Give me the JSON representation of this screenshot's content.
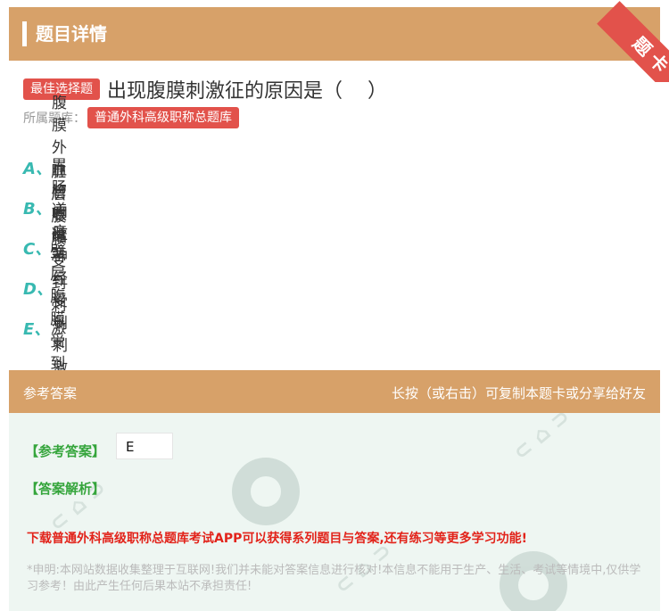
{
  "header": {
    "title": "题目详情",
    "ribbon": "题卡"
  },
  "question": {
    "type_tag": "最佳选择题",
    "text": "出现腹膜刺激征的原因是（    ）",
    "bank_label": "所属题库：",
    "bank_name": "普通外科高级职称总题库"
  },
  "options": [
    {
      "letter": "A、",
      "text": "腹膜外血管收缩"
    },
    {
      "letter": "B、",
      "text": "胃肠道痉挛"
    },
    {
      "letter": "C、",
      "text": "脏层腹膜受到刺激"
    },
    {
      "letter": "D、",
      "text": "内脏神经受到刺激"
    },
    {
      "letter": "E、",
      "text": "壁层腹膜受到刺激"
    }
  ],
  "answer_section": {
    "title": "参考答案",
    "hint": "长按（或右击）可复制本题卡或分享给好友",
    "answer_label": "【参考答案】",
    "answer_value": "E",
    "analysis_label": "【答案解析】",
    "promo": "下载普通外科高级职称总题库考试APP可以获得系列题目与答案,还有练习等更多学习功能!",
    "disclaimer": "*申明:本网站数据收集整理于互联网!我们并未能对答案信息进行核对!本信息不能用于生产、生活、考试等情境中,仅供学习参考！由此产生任何后果本站不承担责任!"
  },
  "colors": {
    "header": "#d7a169",
    "accent": "#e2524b",
    "option_letter": "#38b9b1",
    "answer_green": "#35a53c",
    "promo_red": "#e2231a"
  }
}
